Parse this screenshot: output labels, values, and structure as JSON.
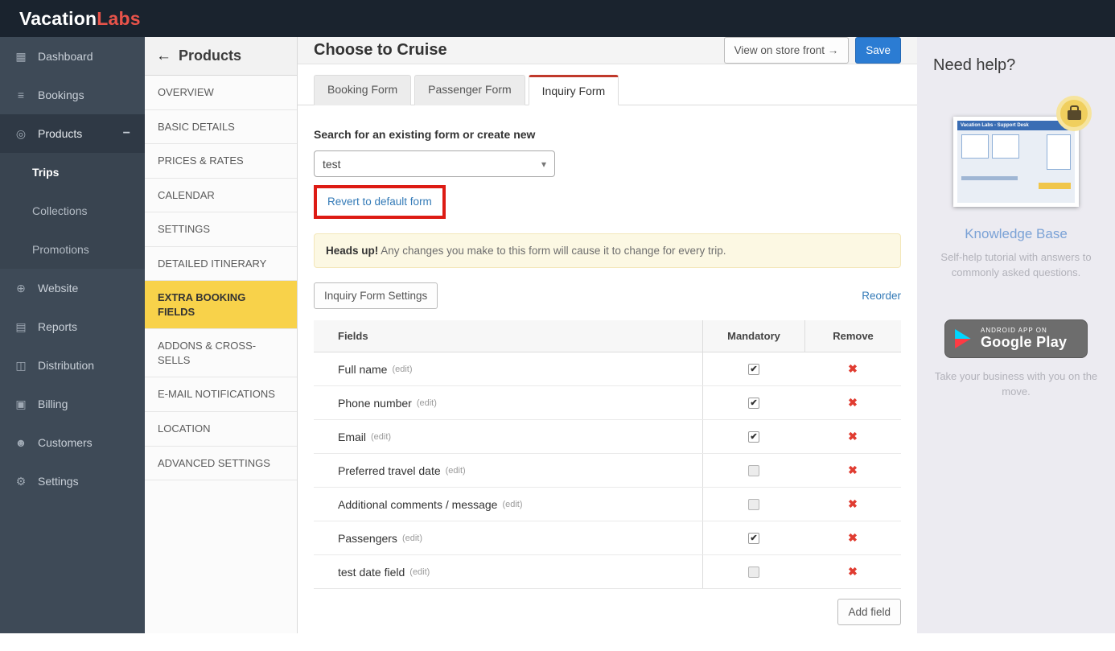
{
  "brand": {
    "part1": "Vacation",
    "part2": "Labs"
  },
  "icons": {
    "dashboard": "▦",
    "bookings": "≡",
    "products": "◎",
    "website": "⊕",
    "reports": "▤",
    "distribution": "◫",
    "billing": "▣",
    "customers": "☻",
    "settings": "⚙",
    "collapse_minus": "−",
    "back_arrow": "←",
    "caret_down": "▾",
    "remove": "✖"
  },
  "sidebar": {
    "items": [
      {
        "label": "Dashboard"
      },
      {
        "label": "Bookings"
      },
      {
        "label": "Products"
      },
      {
        "label": "Trips"
      },
      {
        "label": "Collections"
      },
      {
        "label": "Promotions"
      },
      {
        "label": "Website"
      },
      {
        "label": "Reports"
      },
      {
        "label": "Distribution"
      },
      {
        "label": "Billing"
      },
      {
        "label": "Customers"
      },
      {
        "label": "Settings"
      }
    ]
  },
  "product_nav": {
    "back_label": "Products",
    "items": [
      "OVERVIEW",
      "BASIC DETAILS",
      "PRICES & RATES",
      "CALENDAR",
      "SETTINGS",
      "DETAILED ITINERARY",
      "EXTRA BOOKING FIELDS",
      "ADDONS & CROSS-SELLS",
      "E-MAIL NOTIFICATIONS",
      "LOCATION",
      "ADVANCED SETTINGS"
    ]
  },
  "header": {
    "title": "Choose to Cruise",
    "view_store_label": "View on store front →",
    "save_label": "Save"
  },
  "tabs": [
    {
      "label": "Booking Form"
    },
    {
      "label": "Passenger Form"
    },
    {
      "label": "Inquiry Form"
    }
  ],
  "form": {
    "search_label": "Search for an existing form or create new",
    "select_value": "test",
    "revert_link": "Revert to default form",
    "warning_bold": "Heads up!",
    "warning_text": " Any changes you make to this form will cause it to change for every trip.",
    "settings_button": "Inquiry Form Settings",
    "reorder_link": "Reorder",
    "add_field_button": "Add field"
  },
  "table": {
    "headers": {
      "fields": "Fields",
      "mandatory": "Mandatory",
      "remove": "Remove"
    },
    "edit_label": "(edit)",
    "rows": [
      {
        "name": "Full name",
        "mandatory": true
      },
      {
        "name": "Phone number",
        "mandatory": true
      },
      {
        "name": "Email",
        "mandatory": true
      },
      {
        "name": "Preferred travel date",
        "mandatory": false
      },
      {
        "name": "Additional comments / message",
        "mandatory": false
      },
      {
        "name": "Passengers",
        "mandatory": true
      },
      {
        "name": "test date field",
        "mandatory": false
      }
    ]
  },
  "help": {
    "title": "Need help?",
    "thumb_header": "Vacation Labs - Support Desk",
    "kb_link": "Knowledge Base",
    "kb_text": "Self-help tutorial with answers to commonly asked questions.",
    "play_small": "ANDROID APP ON",
    "play_large": "Google Play",
    "play_text": "Take your business with you on the move."
  }
}
